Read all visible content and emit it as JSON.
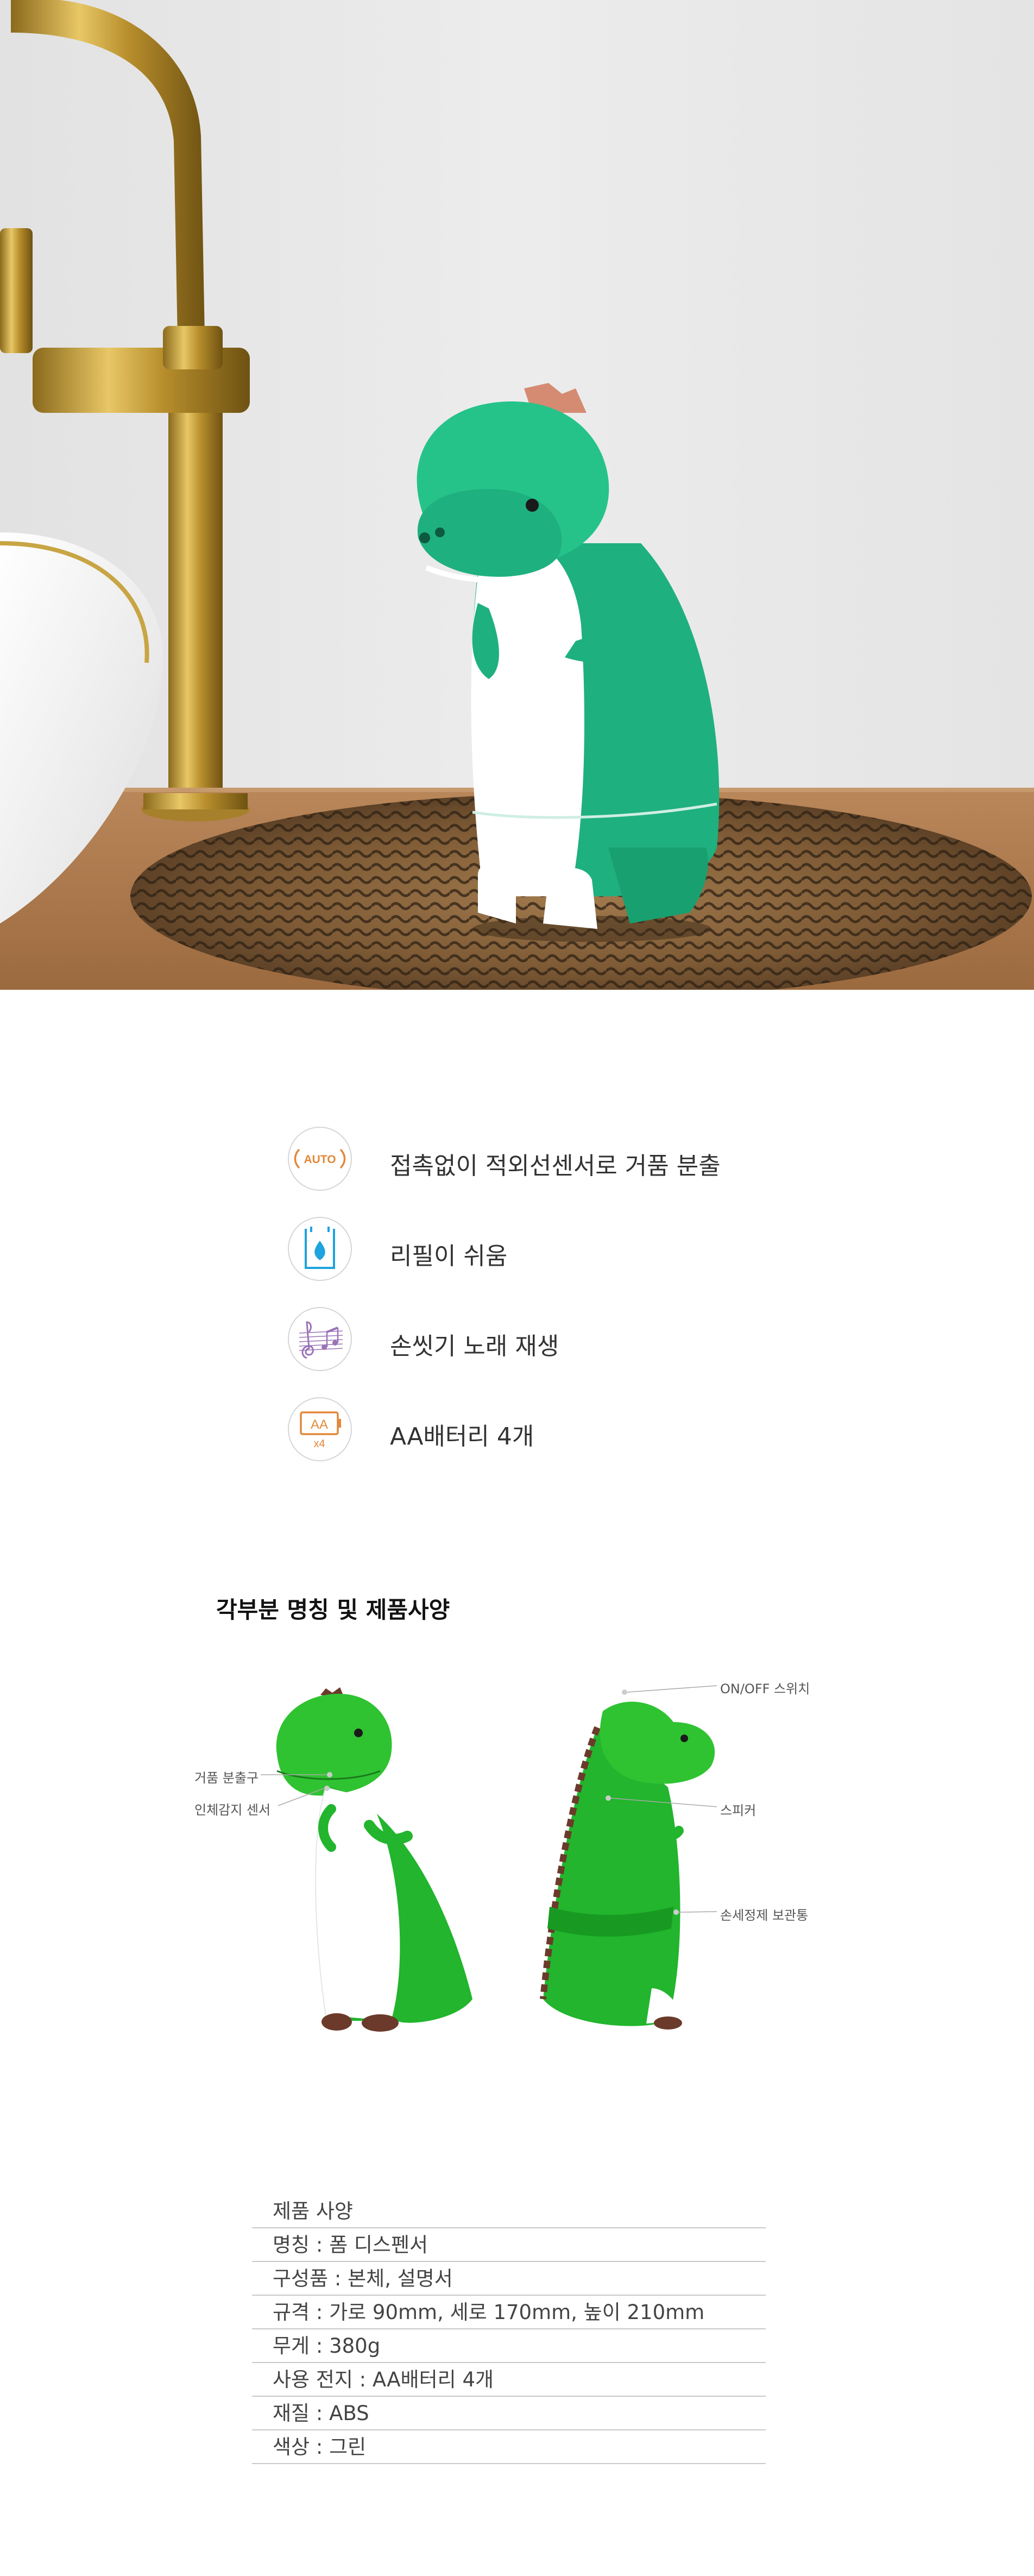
{
  "features": [
    {
      "icon": "auto-icon",
      "icon_text": "AUTO",
      "label": "접촉없이 적외선센서로 거품 분출"
    },
    {
      "icon": "refill-icon",
      "label": "리필이 쉬움"
    },
    {
      "icon": "music-icon",
      "label": "손씻기 노래 재생"
    },
    {
      "icon": "battery-icon",
      "icon_text": "AA",
      "icon_subtext": "x4",
      "label": "AA배터리  4개"
    }
  ],
  "parts": {
    "title": "각부분 명칭 및 제품사양",
    "callouts": {
      "nozzle": "거품 분출구",
      "sensor": "인체감지 센서",
      "switch": "ON/OFF 스위치",
      "speaker": "스피커",
      "storage": "손세정제 보관통"
    }
  },
  "spec": {
    "header": "제품 사양",
    "rows": [
      "명칭 : 폼 디스펜서",
      "구성품 : 본체, 설명서",
      "규격 : 가로 90mm, 세로 170mm, 높이 210mm",
      "무게 : 380g",
      "사용 전지 : AA배터리 4개",
      "재질 : ABS",
      "색상 : 그린"
    ]
  },
  "colors": {
    "dino_green": "#1fb07f",
    "spec_dino_green": "#22b52d",
    "auto_orange": "#e2883a",
    "refill_blue": "#1ea3dc",
    "music_purple": "#9a72b8"
  }
}
